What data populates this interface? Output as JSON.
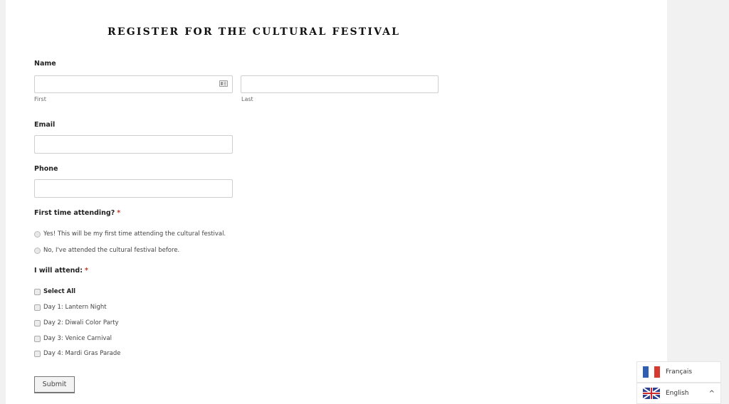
{
  "form": {
    "title": "REGISTER FOR THE CULTURAL FESTIVAL",
    "name": {
      "label": "Name",
      "first_sublabel": "First",
      "last_sublabel": "Last",
      "first_value": "",
      "last_value": ""
    },
    "email": {
      "label": "Email",
      "value": ""
    },
    "phone": {
      "label": "Phone",
      "value": ""
    },
    "first_time": {
      "label": "First time attending?",
      "required_mark": "*",
      "options": [
        "Yes! This will be my first time attending the cultural festival.",
        "No, I've attended the cultural festival before."
      ]
    },
    "attend": {
      "label": "I will attend:",
      "required_mark": "*",
      "select_all": "Select All",
      "options": [
        "Day 1: Lantern Night",
        "Day 2: Diwali Color Party",
        "Day 3: Venice Carnival",
        "Day 4: Mardi Gras Parade"
      ]
    },
    "submit_label": "Submit"
  },
  "language_switcher": {
    "options": [
      {
        "label": "Français",
        "flag": "france-flag"
      },
      {
        "label": "English",
        "flag": "uk-flag",
        "selected": true
      }
    ],
    "toggle_icon": "^"
  },
  "colors": {
    "required": "#c0392b",
    "page_bg": "#f1f1f1"
  }
}
